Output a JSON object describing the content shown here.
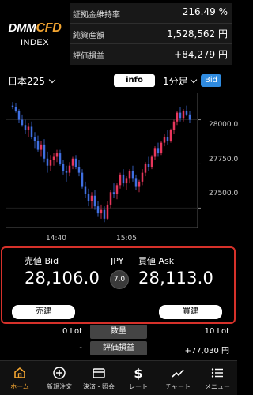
{
  "header": {
    "brand_main": "DMM",
    "brand_accent": "CFD",
    "brand_sub": "INDEX",
    "stats": [
      {
        "label": "証拠金維持率",
        "value": "216.49 %"
      },
      {
        "label": "純資産額",
        "value": "1,528,562 円"
      },
      {
        "label": "評価損益",
        "value": "+84,279 円"
      }
    ]
  },
  "toolbar": {
    "symbol": "日本225",
    "info_label": "info",
    "timeframe": "1分足",
    "bid_label": "Bid"
  },
  "chart_data": {
    "type": "candlestick",
    "y_ticks": [
      "28000.0",
      "27750.0",
      "27500.0"
    ],
    "y_tick_values": [
      28000,
      27750,
      27500
    ],
    "x_ticks": [
      "14:40",
      "15:05"
    ],
    "ylim": [
      27390,
      28150
    ],
    "colors": {
      "up": "#e8365b",
      "down": "#3f6fe0"
    },
    "candles": [
      [
        28080,
        28100,
        28060,
        28070
      ],
      [
        28070,
        28095,
        28040,
        28050
      ],
      [
        28050,
        28060,
        27980,
        28000
      ],
      [
        28000,
        28030,
        27960,
        27970
      ],
      [
        27970,
        28000,
        27920,
        27940
      ],
      [
        27940,
        27980,
        27900,
        27960
      ],
      [
        27960,
        27990,
        27890,
        27900
      ],
      [
        27900,
        27930,
        27840,
        27880
      ],
      [
        27880,
        27910,
        27820,
        27830
      ],
      [
        27830,
        27880,
        27790,
        27860
      ],
      [
        27860,
        27890,
        27760,
        27780
      ],
      [
        27780,
        27820,
        27700,
        27740
      ],
      [
        27740,
        27800,
        27710,
        27770
      ],
      [
        27770,
        27810,
        27740,
        27790
      ],
      [
        27790,
        27830,
        27760,
        27810
      ],
      [
        27810,
        27830,
        27740,
        27750
      ],
      [
        27750,
        27770,
        27690,
        27710
      ],
      [
        27710,
        27740,
        27650,
        27700
      ],
      [
        27700,
        27760,
        27680,
        27740
      ],
      [
        27740,
        27790,
        27720,
        27780
      ],
      [
        27780,
        27800,
        27720,
        27730
      ],
      [
        27730,
        27770,
        27680,
        27700
      ],
      [
        27700,
        27720,
        27610,
        27620
      ],
      [
        27620,
        27650,
        27560,
        27580
      ],
      [
        27580,
        27610,
        27510,
        27540
      ],
      [
        27540,
        27590,
        27500,
        27570
      ],
      [
        27570,
        27600,
        27490,
        27510
      ],
      [
        27510,
        27540,
        27450,
        27470
      ],
      [
        27470,
        27520,
        27440,
        27490
      ],
      [
        27490,
        27510,
        27420,
        27440
      ],
      [
        27440,
        27540,
        27430,
        27520
      ],
      [
        27520,
        27600,
        27500,
        27590
      ],
      [
        27590,
        27640,
        27560,
        27580
      ],
      [
        27580,
        27640,
        27550,
        27630
      ],
      [
        27630,
        27700,
        27610,
        27690
      ],
      [
        27690,
        27720,
        27620,
        27640
      ],
      [
        27640,
        27680,
        27600,
        27670
      ],
      [
        27670,
        27720,
        27640,
        27710
      ],
      [
        27710,
        27740,
        27650,
        27670
      ],
      [
        27670,
        27690,
        27600,
        27620
      ],
      [
        27620,
        27660,
        27590,
        27650
      ],
      [
        27650,
        27720,
        27630,
        27700
      ],
      [
        27700,
        27760,
        27680,
        27750
      ],
      [
        27750,
        27790,
        27710,
        27730
      ],
      [
        27730,
        27800,
        27720,
        27790
      ],
      [
        27790,
        27850,
        27770,
        27840
      ],
      [
        27840,
        27870,
        27790,
        27810
      ],
      [
        27810,
        27880,
        27800,
        27870
      ],
      [
        27870,
        27920,
        27850,
        27900
      ],
      [
        27900,
        27940,
        27860,
        27880
      ],
      [
        27880,
        27950,
        27870,
        27940
      ],
      [
        27940,
        28000,
        27920,
        27990
      ],
      [
        27990,
        28050,
        27970,
        28040
      ],
      [
        28040,
        28070,
        27990,
        28010
      ],
      [
        28010,
        28060,
        27990,
        28050
      ],
      [
        28050,
        28080,
        28020,
        28030
      ],
      [
        28030,
        28050,
        27980,
        28000
      ]
    ]
  },
  "quote": {
    "bid_label": "売値 Bid",
    "ask_label": "買値 Ask",
    "bid_price": "28,106.0",
    "ask_price": "28,113.0",
    "currency": "JPY",
    "spread": "7.0",
    "sell_button": "売建",
    "buy_button": "買建"
  },
  "positions": {
    "rows": [
      {
        "left": "0 Lot",
        "center": "数量",
        "right": "10 Lot"
      },
      {
        "left": "-",
        "center": "評価損益",
        "right": "+77,030 円"
      }
    ]
  },
  "nav": {
    "items": [
      {
        "label": "ホーム",
        "icon": "home-icon"
      },
      {
        "label": "新規注文",
        "icon": "plus-circle-icon"
      },
      {
        "label": "決済・照会",
        "icon": "wallet-icon"
      },
      {
        "label": "レート",
        "icon": "dollar-icon"
      },
      {
        "label": "チャート",
        "icon": "chart-line-icon"
      },
      {
        "label": "メニュー",
        "icon": "menu-icon"
      }
    ],
    "active_color": "#f3a531"
  }
}
